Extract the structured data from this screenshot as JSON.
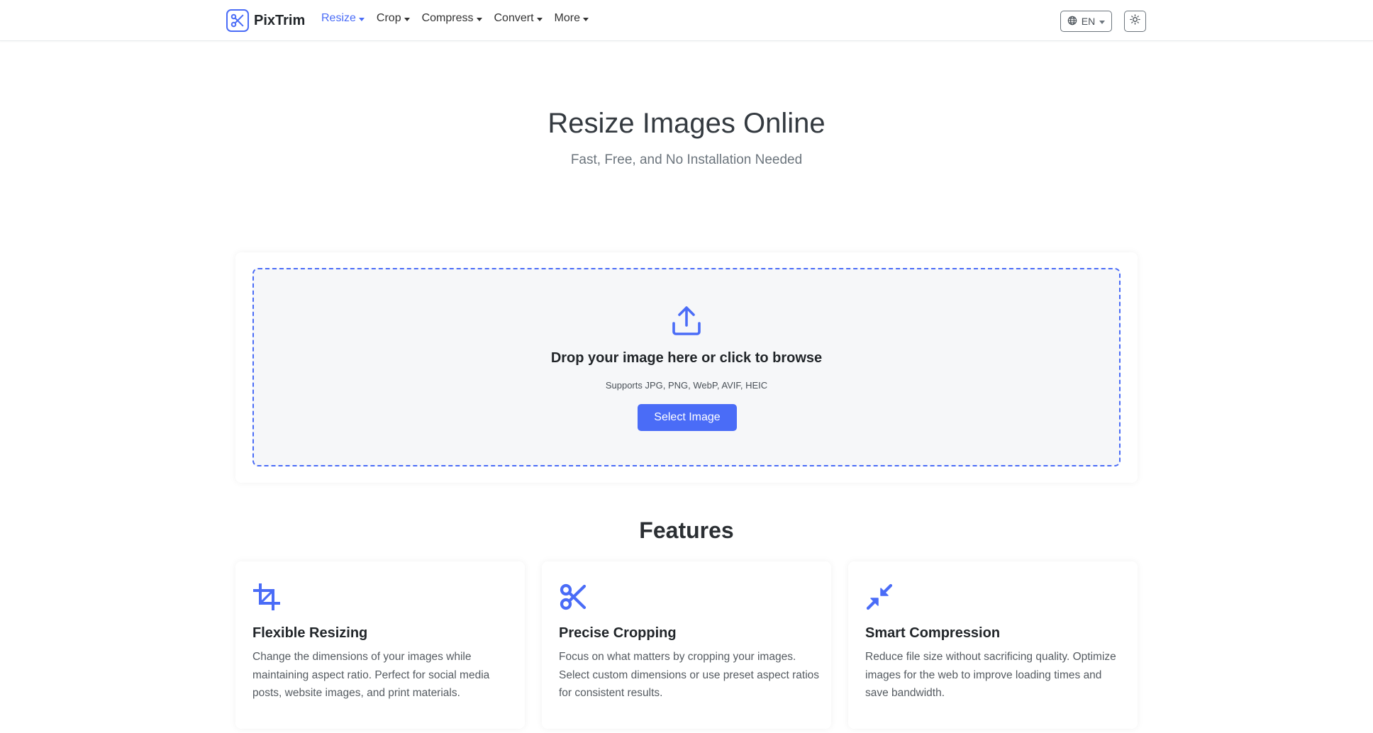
{
  "nav": {
    "brand": "PixTrim",
    "links": [
      {
        "label": "Resize",
        "active": true
      },
      {
        "label": "Crop",
        "active": false
      },
      {
        "label": "Compress",
        "active": false
      },
      {
        "label": "Convert",
        "active": false
      },
      {
        "label": "More",
        "active": false
      }
    ],
    "language": "EN",
    "language_icon": "globe-icon",
    "theme_icon": "sun-icon"
  },
  "hero": {
    "title": "Resize Images Online",
    "subtitle": "Fast, Free, and No Installation Needed"
  },
  "upload": {
    "icon": "upload-icon",
    "title": "Drop your image here or click to browse",
    "supports": "Supports JPG, PNG, WebP, AVIF, HEIC",
    "button": "Select Image"
  },
  "features": {
    "title": "Features",
    "items": [
      {
        "icon": "crop-icon",
        "title": "Flexible Resizing",
        "description": "Change the dimensions of your images while maintaining aspect ratio. Perfect for social media posts, website images, and print materials."
      },
      {
        "icon": "scissors-icon",
        "title": "Precise Cropping",
        "description": "Focus on what matters by cropping your images. Select custom dimensions or use preset aspect ratios for consistent results."
      },
      {
        "icon": "compress-arrows-icon",
        "title": "Smart Compression",
        "description": "Reduce file size without sacrificing quality. Optimize images for the web to improve loading times and save bandwidth."
      }
    ]
  },
  "colors": {
    "accent": "#4a6cf7",
    "dropzone_bg": "#f6f7f9",
    "text": "#212529",
    "muted": "#6c757d"
  }
}
